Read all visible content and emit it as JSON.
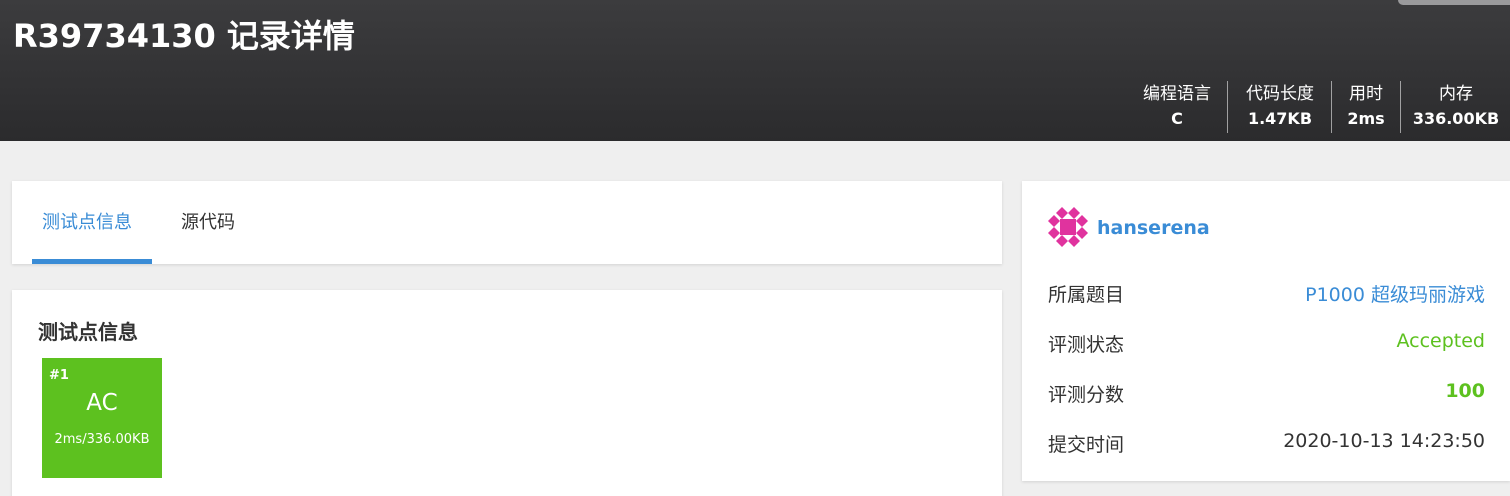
{
  "header": {
    "title": "R39734130 记录详情",
    "stats": [
      {
        "label": "编程语言",
        "value": "C"
      },
      {
        "label": "代码长度",
        "value": "1.47KB"
      },
      {
        "label": "用时",
        "value": "2ms"
      },
      {
        "label": "内存",
        "value": "336.00KB"
      }
    ]
  },
  "tabs": [
    {
      "label": "测试点信息",
      "active": true
    },
    {
      "label": "源代码",
      "active": false
    }
  ],
  "testcases_section": {
    "title": "测试点信息",
    "cases": [
      {
        "num": "#1",
        "status": "AC",
        "meta": "2ms/336.00KB",
        "color": "#5dc11f"
      }
    ]
  },
  "submission": {
    "username": "hanserena",
    "avatar_icon": "identicon-avatar",
    "rows": [
      {
        "label": "所属题目",
        "value": "P1000 超级玛丽游戏"
      },
      {
        "label": "评测状态",
        "value": "Accepted"
      },
      {
        "label": "评测分数",
        "value": "100"
      },
      {
        "label": "提交时间",
        "value": "2020-10-13 14:23:50"
      }
    ]
  },
  "colors": {
    "accent": "#3a8cd6",
    "accepted": "#5dc11f",
    "avatar": "#e0339e",
    "header_bg": "#333335"
  }
}
